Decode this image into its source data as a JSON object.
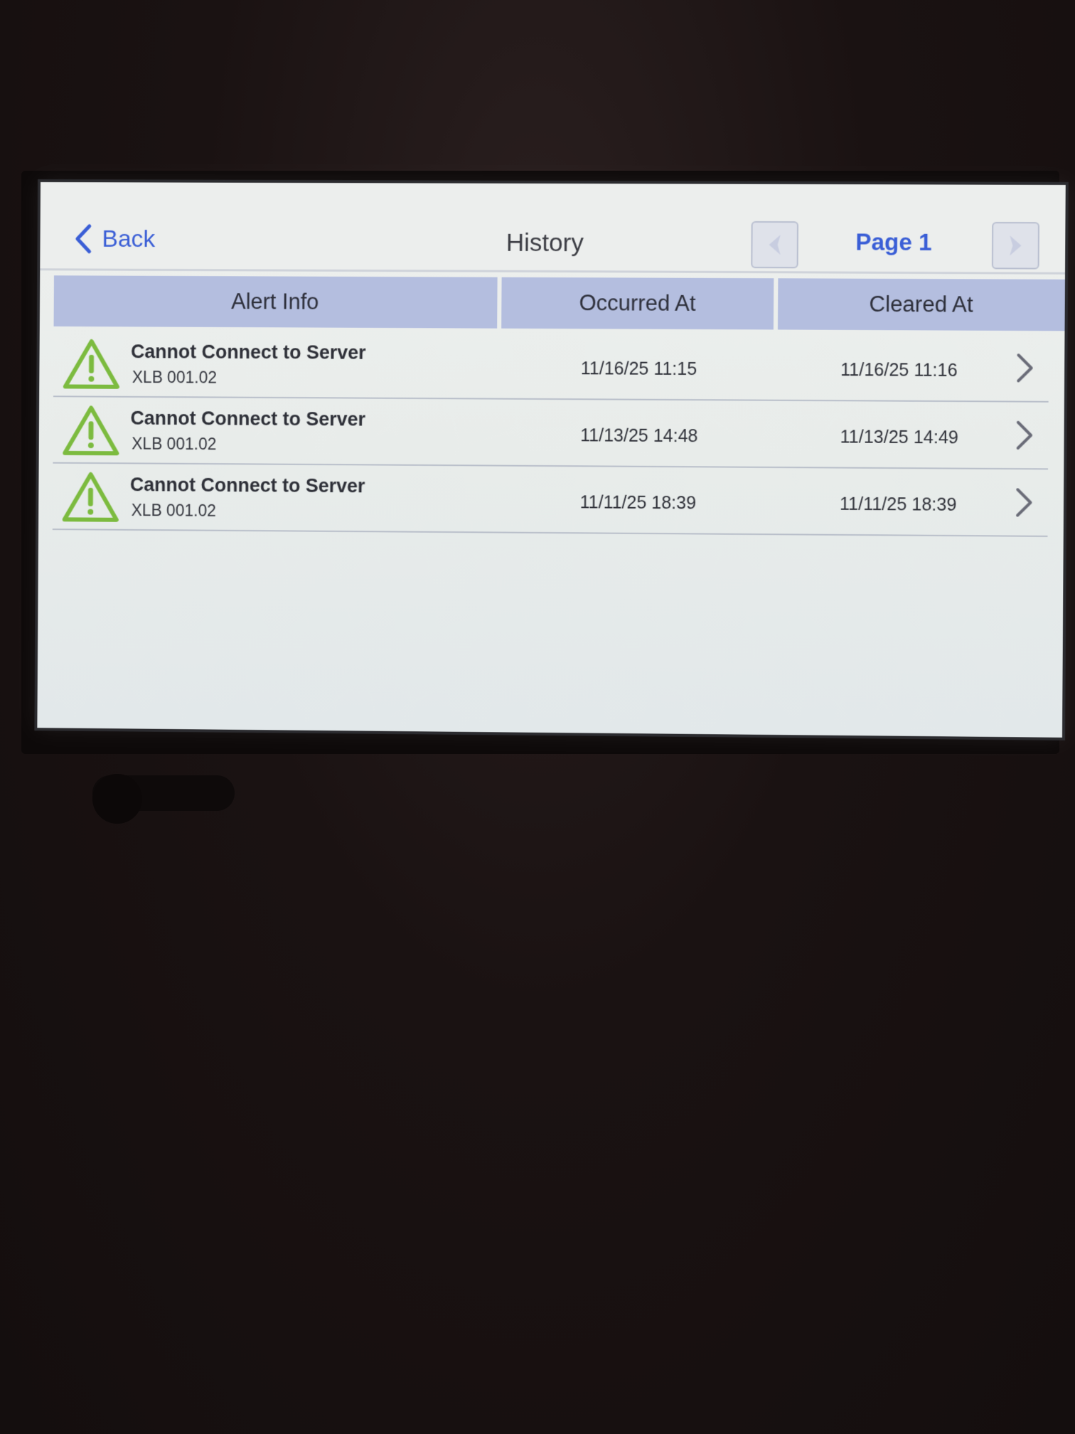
{
  "header": {
    "back_label": "Back",
    "title": "History",
    "page_label": "Page 1"
  },
  "table": {
    "columns": [
      "Alert Info",
      "Occurred At",
      "Cleared At"
    ],
    "rows": [
      {
        "title": "Cannot Connect to Server",
        "code": "XLB 001.02",
        "occurred": "11/16/25 11:15",
        "cleared": "11/16/25 11:16"
      },
      {
        "title": "Cannot Connect to Server",
        "code": "XLB 001.02",
        "occurred": "11/13/25 14:48",
        "cleared": "11/13/25 14:49"
      },
      {
        "title": "Cannot Connect to Server",
        "code": "XLB 001.02",
        "occurred": "11/11/25 18:39",
        "cleared": "11/11/25 18:39"
      }
    ]
  },
  "colors": {
    "accent": "#3a5ed6",
    "header_bg": "#b4bedf",
    "warning": "#7cbb3f"
  },
  "icons": {
    "back": "chevron-left-icon",
    "prev": "chevron-left-icon",
    "next": "chevron-right-icon",
    "alert": "warning-triangle-icon",
    "row_detail": "chevron-right-icon"
  }
}
